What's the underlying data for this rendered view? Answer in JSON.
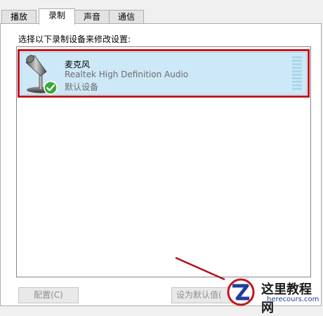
{
  "tabs": [
    {
      "label": "播放",
      "active": false
    },
    {
      "label": "录制",
      "active": true
    },
    {
      "label": "声音",
      "active": false
    },
    {
      "label": "通信",
      "active": false
    }
  ],
  "instruction": "选择以下录制设备来修改设置:",
  "device": {
    "name": "麦克风",
    "driver": "Realtek High Definition Audio",
    "status": "默认设备",
    "icon": "microphone-icon",
    "status_icon": "green-check-icon",
    "level": 0
  },
  "buttons": {
    "configure": "配置(C)",
    "set_default": "设为默认值("
  },
  "watermark": {
    "title": "这里教程网",
    "url": "herecours.com"
  },
  "colors": {
    "selection": "#cde8f7",
    "highlight_border": "#c3161c",
    "check_green": "#3aa83a",
    "annotation_arrow": "#b3131a"
  }
}
